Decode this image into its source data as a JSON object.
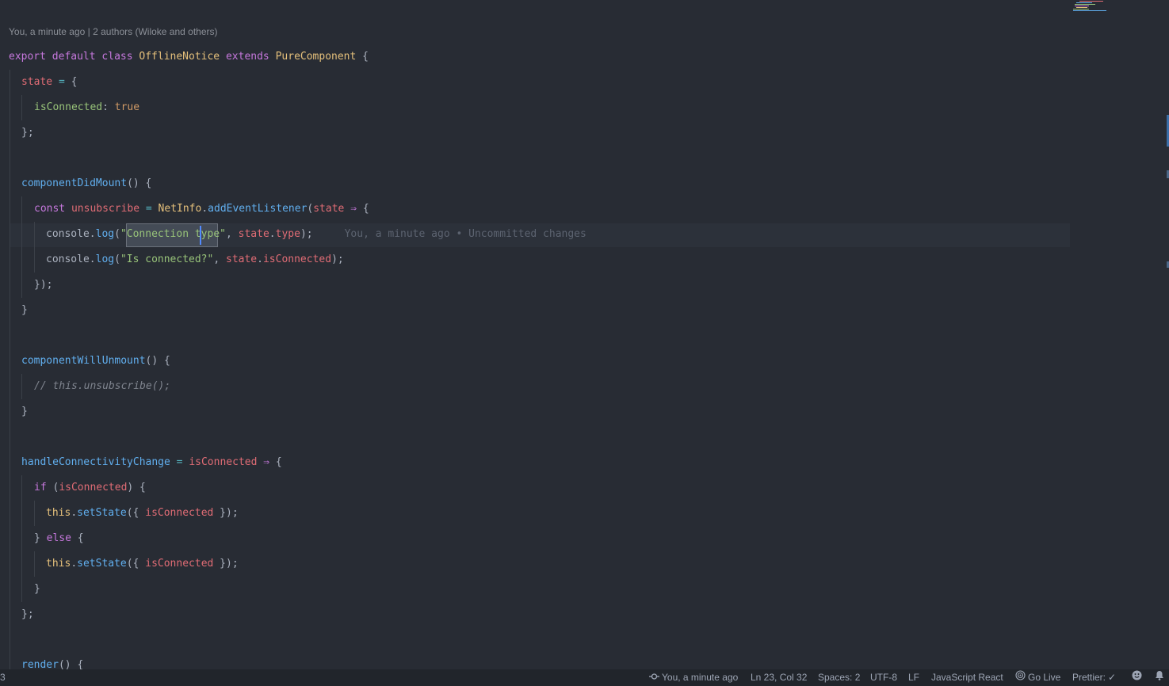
{
  "codelens": "You, a minute ago | 2 authors (Wiloke and others)",
  "code": {
    "l1": {
      "kw1": "export",
      "kw2": "default",
      "kw3": "class",
      "cls": "OfflineNotice",
      "kw4": "extends",
      "base": "PureComponent",
      "p": " {"
    },
    "l2": {
      "v": "state",
      "op": " = ",
      "p": "{"
    },
    "l3": {
      "prop": "isConnected",
      "p": ": ",
      "val": "true"
    },
    "l4": {
      "p": "};"
    },
    "l5": {
      "fn": "componentDidMount",
      "p": "() {"
    },
    "l6": {
      "kw": "const",
      "v": "unsubscribe",
      "op": " = ",
      "c": "NetInfo",
      "dot": ".",
      "fn": "addEventListener",
      "p1": "(",
      "arg": "state",
      "arrow": "⇒",
      "p2": " {"
    },
    "l7": {
      "obj": "console",
      "dot": ".",
      "fn": "log",
      "p1": "(",
      "str": "\"Connection type\"",
      "p2": ", ",
      "v": "state",
      "dot2": ".",
      "prop": "type",
      "p3": ");",
      "blame": "You, a minute ago • Uncommitted changes"
    },
    "l8": {
      "obj": "console",
      "dot": ".",
      "fn": "log",
      "p1": "(",
      "str": "\"Is connected?\"",
      "p2": ", ",
      "v": "state",
      "dot2": ".",
      "prop": "isConnected",
      "p3": ");"
    },
    "l9": {
      "p": "});"
    },
    "l10": {
      "p": "}"
    },
    "l11": {
      "fn": "componentWillUnmount",
      "p": "() {"
    },
    "l12": {
      "cm": "// this.unsubscribe();"
    },
    "l13": {
      "p": "}"
    },
    "l14": {
      "fn": "handleConnectivityChange",
      "op": " = ",
      "arg": "isConnected",
      "arrow": "⇒",
      "p": " {"
    },
    "l15": {
      "kw": "if",
      "p1": " (",
      "v": "isConnected",
      "p2": ") {"
    },
    "l16": {
      "th": "this",
      "dot": ".",
      "fn": "setState",
      "p1": "({ ",
      "v": "isConnected",
      "p2": " });"
    },
    "l17": {
      "p1": "} ",
      "kw": "else",
      "p2": " {"
    },
    "l18": {
      "th": "this",
      "dot": ".",
      "fn": "setState",
      "p1": "({ ",
      "v": "isConnected",
      "p2": " });"
    },
    "l19": {
      "p": "}"
    },
    "l20": {
      "p": "};"
    },
    "l21": {
      "fn": "render",
      "p": "() {"
    }
  },
  "statusbar": {
    "left_num": "3",
    "git_blame": "You, a minute ago",
    "position": "Ln 23, Col 32",
    "spaces": "Spaces: 2",
    "encoding": "UTF-8",
    "eol": "LF",
    "language": "JavaScript React",
    "golive": "Go Live",
    "prettier": "Prettier:",
    "prettier_check": "✓"
  },
  "icons": [
    "git-commit-icon",
    "broadcast-icon",
    "smiley-icon",
    "bell-icon"
  ],
  "colors": {
    "background": "#282c34",
    "keyword": "#c678dd",
    "class": "#e5c07b",
    "variable": "#e06c75",
    "function": "#61afef",
    "string": "#98c379",
    "operator": "#56b6c2",
    "number": "#d19a66",
    "statusbar": "#21252b"
  }
}
